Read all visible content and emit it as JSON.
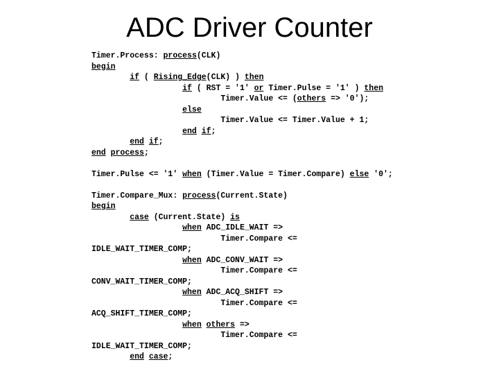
{
  "title": "ADC Driver Counter",
  "code": {
    "l1a": "Timer.Process: ",
    "l1b": "process",
    "l1c": "(CLK)",
    "l2": "begin",
    "l3a": "        ",
    "l3b": "if",
    "l3c": " ( ",
    "l3d": "Rising_Edge",
    "l3e": "(CLK) ) ",
    "l3f": "then",
    "l4a": "                   ",
    "l4b": "if",
    "l4c": " ( RST = '1' ",
    "l4d": "or",
    "l4e": " Timer.Pulse = '1' ) ",
    "l4f": "then",
    "l5a": "                           Timer.Value <= (",
    "l5b": "others",
    "l5c": " => '0');",
    "l6a": "                   ",
    "l6b": "else",
    "l7": "                           Timer.Value <= Timer.Value + 1;",
    "l8a": "                   ",
    "l8b": "end",
    "l8c": " ",
    "l8d": "if",
    "l8e": ";",
    "l9a": "        ",
    "l9b": "end",
    "l9c": " ",
    "l9d": "if",
    "l9e": ";",
    "l10a": "end",
    "l10b": " ",
    "l10c": "process",
    "l10d": ";",
    "l11a": "Timer.Pulse <= '1' ",
    "l11b": "when",
    "l11c": " (Timer.Value = Timer.Compare) ",
    "l11d": "else",
    "l11e": " '0';",
    "l12a": "Timer.Compare_Mux: ",
    "l12b": "process",
    "l12c": "(Current.State)",
    "l13": "begin",
    "l14a": "        ",
    "l14b": "case",
    "l14c": " (Current.State) ",
    "l14d": "is",
    "l15a": "                   ",
    "l15b": "when",
    "l15c": " ADC_IDLE_WAIT =>",
    "l16": "                           Timer.Compare <=",
    "l17": "IDLE_WAIT_TIMER_COMP;",
    "l18a": "                   ",
    "l18b": "when",
    "l18c": " ADC_CONV_WAIT =>",
    "l19": "                           Timer.Compare <=",
    "l20": "CONV_WAIT_TIMER_COMP;",
    "l21a": "                   ",
    "l21b": "when",
    "l21c": " ADC_ACQ_SHIFT =>",
    "l22": "                           Timer.Compare <=",
    "l23": "ACQ_SHIFT_TIMER_COMP;",
    "l24a": "                   ",
    "l24b": "when",
    "l24c": " ",
    "l24d": "others",
    "l24e": " =>",
    "l25": "                           Timer.Compare <=",
    "l26": "IDLE_WAIT_TIMER_COMP;",
    "l27a": "        ",
    "l27b": "end",
    "l27c": " ",
    "l27d": "case",
    "l27e": ";"
  }
}
